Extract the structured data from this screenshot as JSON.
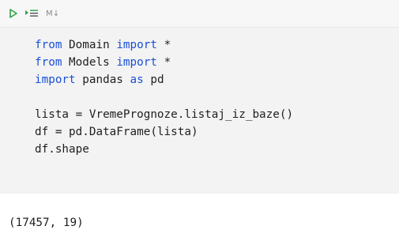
{
  "toolbar": {
    "run_icon": "play-icon",
    "run_above_icon": "run-above-icon",
    "markdown_label": "M↓",
    "accent_color": "#2ea043"
  },
  "code": {
    "line1": {
      "kw1": "from",
      "mod": " Domain ",
      "kw2": "import",
      "rest": " *"
    },
    "line2": {
      "kw1": "from",
      "mod": " Models ",
      "kw2": "import",
      "rest": " *"
    },
    "line3": {
      "kw1": "import",
      "mid": " pandas ",
      "kw2": "as",
      "rest": " pd"
    },
    "line5": "lista = VremePrognoze.listaj_iz_baze()",
    "line6": "df = pd.DataFrame(lista)",
    "line7": "df.shape",
    "keyword_color": "#1a4fd6"
  },
  "output": {
    "text": "(17457, 19)"
  }
}
